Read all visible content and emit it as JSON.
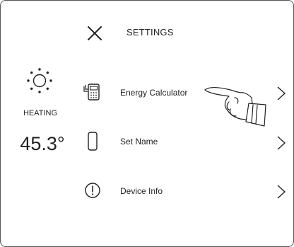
{
  "header": {
    "close_icon": "close-icon",
    "title": "SETTINGS"
  },
  "status": {
    "mode_icon": "sun-icon",
    "mode_label": "HEATING",
    "temperature": "45.3°"
  },
  "menu": {
    "items": [
      {
        "label": "Energy Calculator",
        "icon": "energy-meter-icon"
      },
      {
        "label": "Set Name",
        "icon": "device-cylinder-icon"
      },
      {
        "label": "Device Info",
        "icon": "info-exclamation-icon"
      }
    ],
    "chevron_icon": "chevron-right-icon"
  },
  "overlay": {
    "pointer_icon": "pointing-hand-icon"
  }
}
